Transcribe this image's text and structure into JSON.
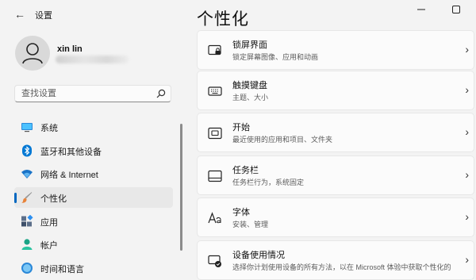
{
  "window": {
    "title": "设置"
  },
  "user": {
    "name": "xin lin"
  },
  "search": {
    "placeholder": "查找设置"
  },
  "nav": {
    "items": [
      {
        "label": "系统"
      },
      {
        "label": "蓝牙和其他设备"
      },
      {
        "label": "网络 & Internet"
      },
      {
        "label": "个性化",
        "selected": true
      },
      {
        "label": "应用"
      },
      {
        "label": "帐户"
      },
      {
        "label": "时间和语言"
      }
    ]
  },
  "main": {
    "title": "个性化",
    "cards": [
      {
        "title": "锁屏界面",
        "desc": "锁定屏幕图像、应用和动画",
        "icon": "lock-screen-icon"
      },
      {
        "title": "触摸键盘",
        "desc": "主题、大小",
        "icon": "keyboard-icon"
      },
      {
        "title": "开始",
        "desc": "最近使用的应用和项目、文件夹",
        "icon": "start-icon"
      },
      {
        "title": "任务栏",
        "desc": "任务栏行为，系统固定",
        "icon": "taskbar-icon"
      },
      {
        "title": "字体",
        "desc": "安装、管理",
        "icon": "fonts-icon"
      },
      {
        "title": "设备使用情况",
        "desc": "选择你计划使用设备的所有方法，以在 Microsoft 体验中获取个性化的",
        "icon": "device-usage-icon"
      }
    ]
  },
  "colors": {
    "accent": "#0067c0",
    "background": "#f3f3f3",
    "card": "#fbfbfb"
  }
}
